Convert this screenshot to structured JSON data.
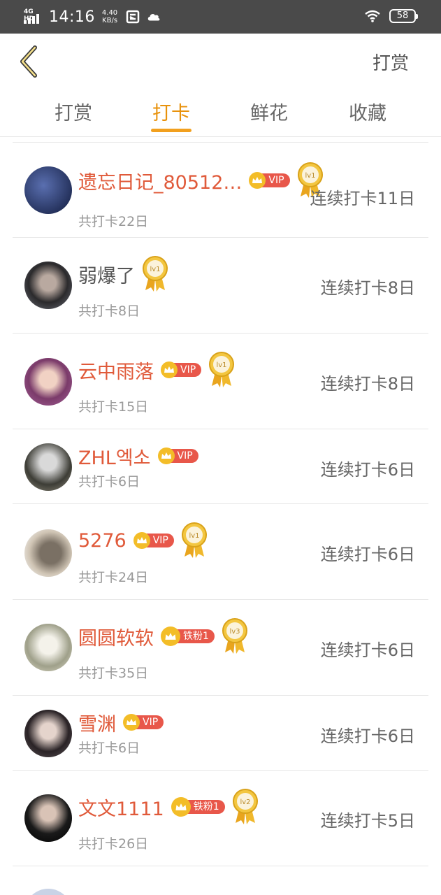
{
  "status_bar": {
    "network": "4G HD",
    "time": "14:16",
    "speed_value": "4.40",
    "speed_unit": "KB/s",
    "battery": "58"
  },
  "header": {
    "action_label": "打赏"
  },
  "tabs": [
    {
      "label": "打赏",
      "active": false
    },
    {
      "label": "打卡",
      "active": true
    },
    {
      "label": "鲜花",
      "active": false
    },
    {
      "label": "收藏",
      "active": false
    }
  ],
  "colors": {
    "accent": "#f2a01e",
    "name_red": "#e05a3a",
    "badge_red": "#e8574a",
    "gold": "#f3bd28"
  },
  "rows": [
    {
      "name": "遗忘日记_80512…",
      "vip": true,
      "badge": "VIP",
      "medal": "lv1",
      "total": "共打卡22日",
      "streak": "连续打卡11日",
      "highlight": true
    },
    {
      "name": "弱爆了",
      "vip": false,
      "badge": "",
      "medal": "lv1",
      "total": "共打卡8日",
      "streak": "连续打卡8日",
      "highlight": false
    },
    {
      "name": "云中雨落",
      "vip": true,
      "badge": "VIP",
      "medal": "lv1",
      "total": "共打卡15日",
      "streak": "连续打卡8日",
      "highlight": true
    },
    {
      "name": "ZHL엑소",
      "vip": true,
      "badge": "VIP",
      "medal": "",
      "total": "共打卡6日",
      "streak": "连续打卡6日",
      "highlight": true
    },
    {
      "name": "5276",
      "vip": true,
      "badge": "VIP",
      "medal": "lv1",
      "total": "共打卡24日",
      "streak": "连续打卡6日",
      "highlight": true
    },
    {
      "name": "圆圆软软",
      "vip": true,
      "badge": "铁粉1",
      "medal": "lv3",
      "total": "共打卡35日",
      "streak": "连续打卡6日",
      "highlight": true
    },
    {
      "name": "雪渊",
      "vip": true,
      "badge": "VIP",
      "medal": "",
      "total": "共打卡6日",
      "streak": "连续打卡6日",
      "highlight": true
    },
    {
      "name": "文文1111",
      "vip": true,
      "badge": "铁粉1",
      "medal": "lv2",
      "total": "共打卡26日",
      "streak": "连续打卡5日",
      "highlight": true
    }
  ]
}
